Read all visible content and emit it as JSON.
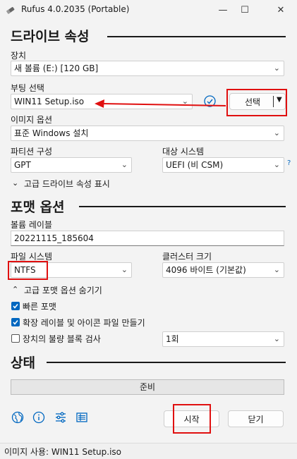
{
  "window": {
    "title": "Rufus 4.0.2035 (Portable)",
    "minimize": "—",
    "maximize": "☐",
    "close": "✕"
  },
  "drive_props": {
    "heading": "드라이브 속성",
    "device_label": "장치",
    "device_value": "새 볼륨 (E:) [120 GB]",
    "boot_label": "부팅 선택",
    "boot_value": "WIN11 Setup.iso",
    "select_button": "선택",
    "image_option_label": "이미지 옵션",
    "image_option_value": "표준 Windows 설치",
    "partition_label": "파티션 구성",
    "partition_value": "GPT",
    "target_label": "대상 시스템",
    "target_value": "UEFI (비 CSM)",
    "help": "?",
    "advanced_toggle": "고급 드라이브 속성 표시"
  },
  "format_opts": {
    "heading": "포맷 옵션",
    "volume_label": "볼륨 레이블",
    "volume_value": "20221115_185604",
    "fs_label": "파일 시스템",
    "fs_value": "NTFS",
    "cluster_label": "클러스터 크기",
    "cluster_value": "4096 바이트 (기본값)",
    "advanced_toggle": "고급 포맷 옵션 숨기기",
    "quick_format": "빠른 포맷",
    "extended_label": "확장 레이블 및 아이콘 파일 만들기",
    "bad_blocks": "장치의 불량 블록 검사",
    "bad_blocks_passes": "1회"
  },
  "status": {
    "heading": "상태",
    "progress_text": "준비",
    "progress_fraction": 0
  },
  "actions": {
    "start": "시작",
    "close": "닫기"
  },
  "statusbar": {
    "text": "이미지 사용: WIN11 Setup.iso"
  },
  "colors": {
    "accent": "#0067c0",
    "highlight_box": "#e01010",
    "arrow": "#e01010"
  }
}
